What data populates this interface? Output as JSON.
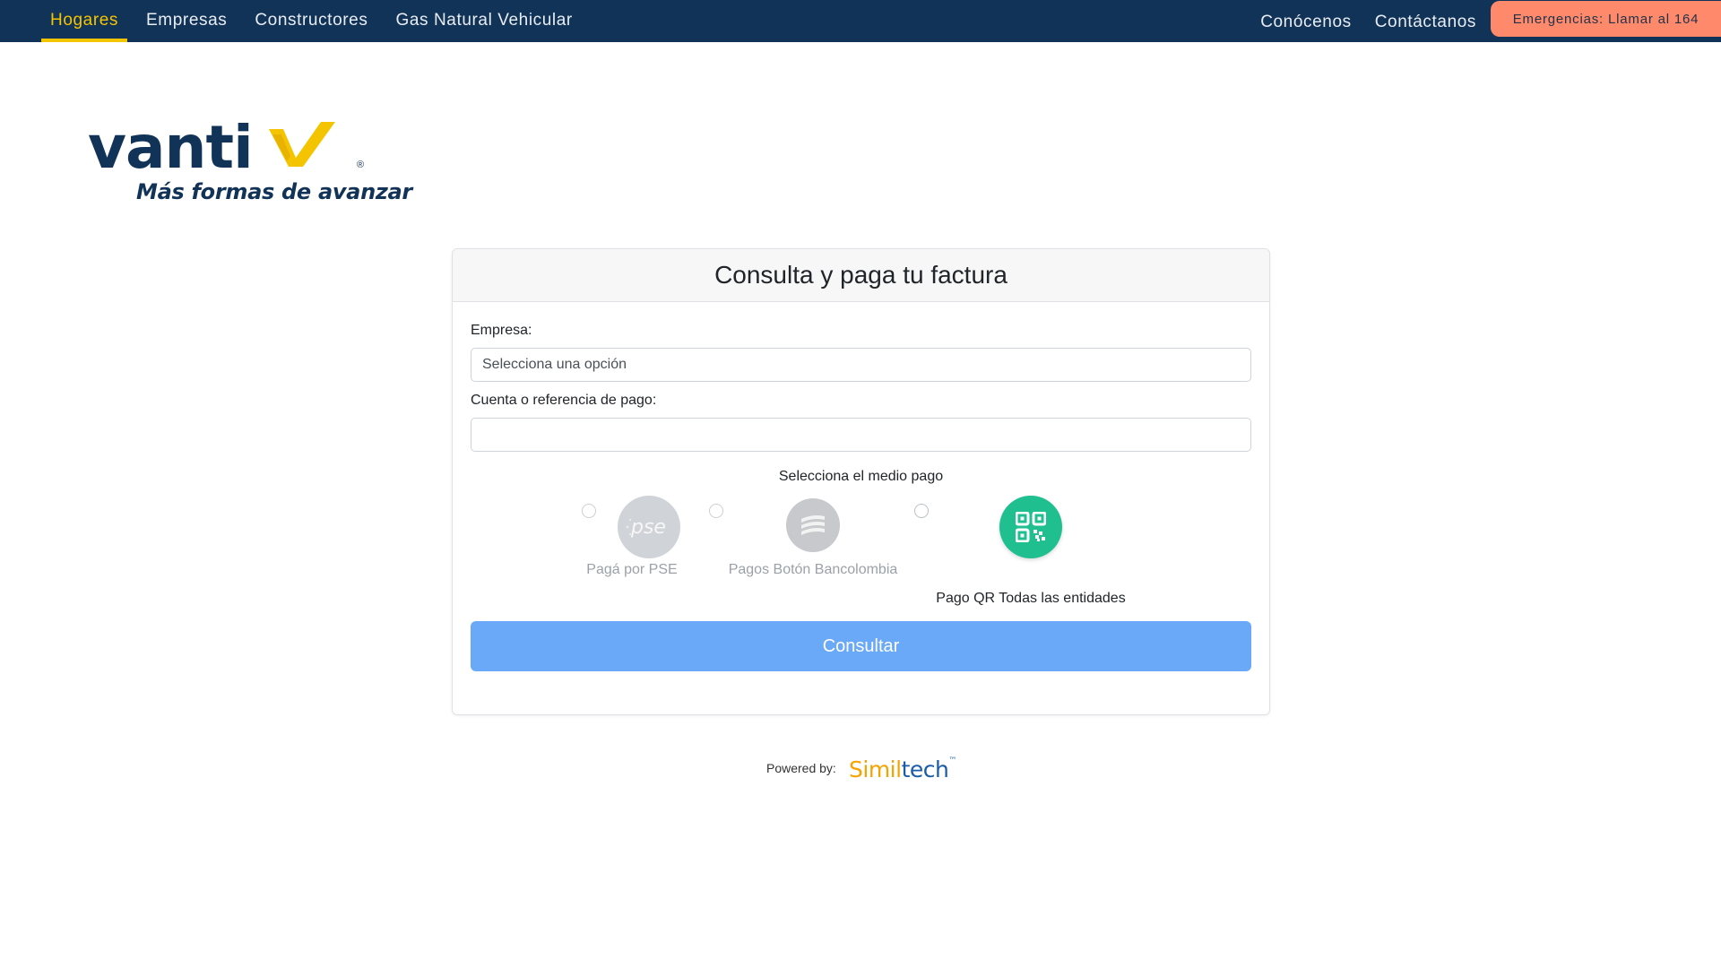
{
  "nav": {
    "left_items": [
      {
        "label": "Hogares",
        "active": true
      },
      {
        "label": "Empresas"
      },
      {
        "label": "Constructores"
      },
      {
        "label": "Gas Natural Vehicular"
      }
    ],
    "right_items": [
      {
        "label": "Conócenos"
      },
      {
        "label": "Contáctanos"
      }
    ],
    "emergency_label": "Emergencias: Llamar al 164"
  },
  "logo": {
    "word": "vanti",
    "registered": "®",
    "tagline": "Más formas de avanzar"
  },
  "card": {
    "title": "Consulta y paga tu factura",
    "empresa_label": "Empresa:",
    "empresa_value": "Selecciona una opción",
    "cuenta_label": "Cuenta o referencia de pago:",
    "cuenta_value": "",
    "payment_section_title": "Selecciona el medio pago",
    "payment_options": [
      {
        "label": "Pagá por PSE",
        "icon": "pse-icon",
        "icon_text": "pse",
        "enabled": false
      },
      {
        "label": "Pagos Botón Bancolombia",
        "icon": "bancolombia-icon",
        "enabled": false
      },
      {
        "label": "Pago QR Todas las entidades",
        "icon": "qr-code-icon",
        "enabled": true
      }
    ],
    "submit_label": "Consultar"
  },
  "footer": {
    "powered_by": "Powered by:",
    "brand_part1": "Simil",
    "brand_part2": "tech",
    "brand_tm": "™"
  },
  "colors": {
    "nav_bg": "#123358",
    "nav_active": "#f5c400",
    "emergency_bg": "#ff8a6b",
    "button_bg": "#6aa8f8",
    "qr_green": "#1fbf8f",
    "logo_navy": "#123358",
    "logo_yellow": "#f5c400"
  }
}
